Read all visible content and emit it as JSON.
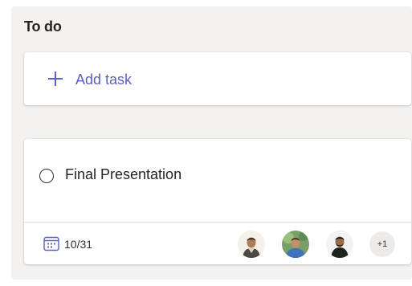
{
  "column": {
    "title": "To do"
  },
  "add_task": {
    "label": "Add task",
    "icon": "plus-icon",
    "accent_color": "#5b5fc7"
  },
  "task": {
    "title": "Final Presentation",
    "completed": false,
    "due_date": "10/31",
    "due_icon": "calendar-icon",
    "assignees": [
      {
        "icon": "avatar-person-1"
      },
      {
        "icon": "avatar-person-2"
      },
      {
        "icon": "avatar-person-3"
      }
    ],
    "more_assignees": "+1"
  }
}
